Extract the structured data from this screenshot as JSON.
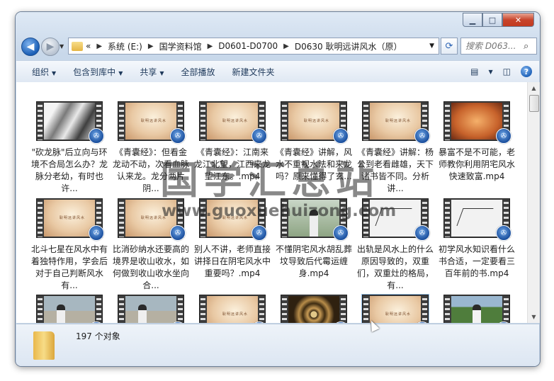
{
  "window": {
    "buttons": {
      "minimize": "▁",
      "maximize": "□",
      "close": "✕"
    }
  },
  "nav": {
    "address": {
      "overflow": "«",
      "crumbs": [
        "系统 (E:)",
        "国学资料馆",
        "D0601-D0700",
        "D0630 耿明远讲风水（原）"
      ]
    },
    "search_placeholder": "搜索 D063..."
  },
  "toolbar": {
    "organize": "组织",
    "include_library": "包含到库中",
    "share": "共享",
    "play_all": "全部播放",
    "new_folder": "新建文件夹"
  },
  "files": [
    {
      "name": "\"砍龙脉\"后立向与环境不合局怎么办？龙脉分老幼，有时也许...",
      "thumb": "ink"
    },
    {
      "name": "《青囊经》：但看金龙动不动，次看血脉认来龙。龙分两片阴...",
      "thumb": "parch"
    },
    {
      "name": "《青囊经》：江南来龙江北望，江西来龙望江东。.mp4",
      "thumb": "parch"
    },
    {
      "name": "《青囊经》讲解，风水不重视水法和来龙吗？原来懂得了玄...",
      "thumb": "parch"
    },
    {
      "name": "《青囊经》讲解：杨公到老看雌雄，天下诸书皆不同。分析讲...",
      "thumb": "parch"
    },
    {
      "name": "暴富不是不可能，老师教你利用阴宅风水快速致富.mp4",
      "thumb": "blur"
    },
    {
      "name": "北斗七星在风水中有着独特作用，学会后对于自己判断风水有...",
      "thumb": "parch"
    },
    {
      "name": "比消砂纳水还要高的境界是收山收水，如何做到收山收水坐向合...",
      "thumb": "parch"
    },
    {
      "name": "别人不讲，老师直接讲择日在阴宅风水中重要吗？.mp4",
      "thumb": "parch"
    },
    {
      "name": "不懂阴宅风水胡乱葬坟导致后代霉运缠身.mp4",
      "thumb": "man"
    },
    {
      "name": "出轨是风水上的什么原因导致的，双重们，双重灶的格局，有...",
      "thumb": "sketch"
    },
    {
      "name": "初学风水知识看什么书合适，一定要看三百年前的书.mp4",
      "thumb": "sketch"
    },
    {
      "name": "",
      "thumb": "court"
    },
    {
      "name": "",
      "thumb": "court"
    },
    {
      "name": "",
      "thumb": "parch"
    },
    {
      "name": "",
      "thumb": "compass"
    },
    {
      "name": "",
      "thumb": "parch"
    },
    {
      "name": "",
      "thumb": "field"
    }
  ],
  "parch_subtitle": "耿明远讲风水",
  "watermark": {
    "title": "国学汇总站",
    "url": "www.guoxuehuizong.com"
  },
  "details": {
    "count": "197 个对象"
  }
}
